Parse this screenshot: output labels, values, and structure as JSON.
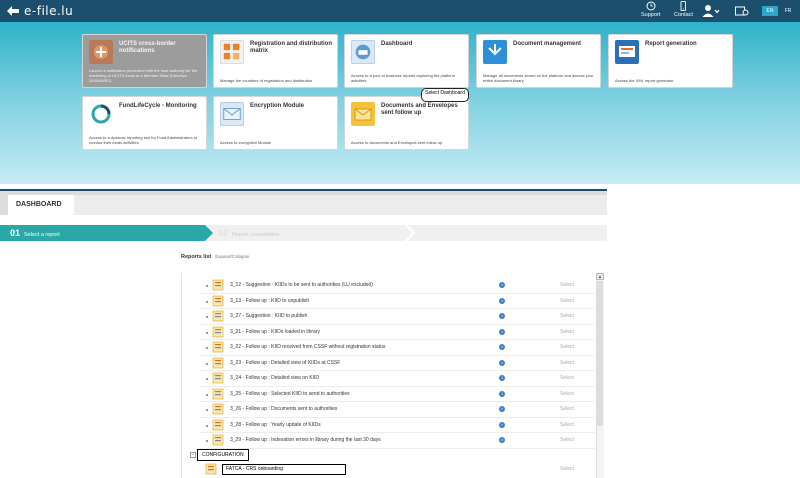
{
  "header": {
    "logo_text": "e-file.lu",
    "support_label": "Support",
    "contact_label": "Contact",
    "languages": [
      "EN",
      "FR"
    ],
    "active_language": "EN"
  },
  "tiles": [
    {
      "title": "UCITS cross-border notifications",
      "desc": "Launch a notification procedure with the host authority for the marketing of UCITS funds in a Member State (Directive 2009/65/EC)",
      "disabled": true,
      "icon": "ucits-icon"
    },
    {
      "title": "Registration and distribution matrix",
      "desc": "Manage the countries of registration and distribution",
      "disabled": false,
      "icon": "matrix-icon"
    },
    {
      "title": "Dashboard",
      "desc": "Access to a pool of business reports capturing the platform activities",
      "disabled": false,
      "icon": "dashboard-icon"
    },
    {
      "title": "Document management",
      "desc": "Manage all documents stored on the platform and access your entire document library",
      "disabled": false,
      "icon": "document-management-icon"
    },
    {
      "title": "Report generation",
      "desc": "Access the XML report generator",
      "disabled": false,
      "icon": "report-generation-icon"
    },
    {
      "title": "FundLifeCycle - Monitoring",
      "desc": "Access to a dynamic reporting tool for Fund Administrators to monitor their funds activities.",
      "disabled": false,
      "icon": "lifecycle-icon"
    },
    {
      "title": "Encryption Module",
      "desc": "Access to encryption Module",
      "disabled": false,
      "icon": "encryption-icon"
    },
    {
      "title": "Documents and Envelopes sent follow up",
      "desc": "Access to documents and Envelopes sent follow up",
      "disabled": false,
      "icon": "envelopes-icon"
    }
  ],
  "tooltip": "Select Dashboard",
  "dashboard": {
    "tab_label": "DASHBOARD",
    "step1_num": "01",
    "step1_label": "Select a report",
    "step2_num": "02",
    "step2_label": "Report consultation",
    "reports_title": "Reports list",
    "reports_sub": "Expand/Collapse"
  },
  "reports": [
    "3_12 - Suggestion : KIIDs to be sent to authorities (LU excluded)",
    "3_13 - Follow up : KIID to unpublish",
    "3_27 - Suggestion : KIID to publish",
    "3_21 - Follow up : KIIDs loaded in library",
    "3_22 - Follow up : KIID received from CSSF without registration status",
    "3_23 - Follow up : Detailed view of KIIDs at CSSF",
    "3_24 - Follow up : Detailed view on KIID",
    "3_25 - Follow up : Selected KIID to send to authorities",
    "3_26 - Follow up : Documents sent to authorities",
    "3_28 - Follow up : Yearly update of KIIDs",
    "3_29 - Follow up : Indexation errors in library during the last 30 days"
  ],
  "select_label": "Select",
  "info_glyph": "i",
  "configuration": {
    "toggle": "−",
    "label": "CONFIGURATION",
    "item": "FATCA - CRS onboarding"
  },
  "colors": {
    "topbar": "#1c4f6d",
    "accent": "#2aa8c8",
    "step_active": "#2aa8a8"
  }
}
